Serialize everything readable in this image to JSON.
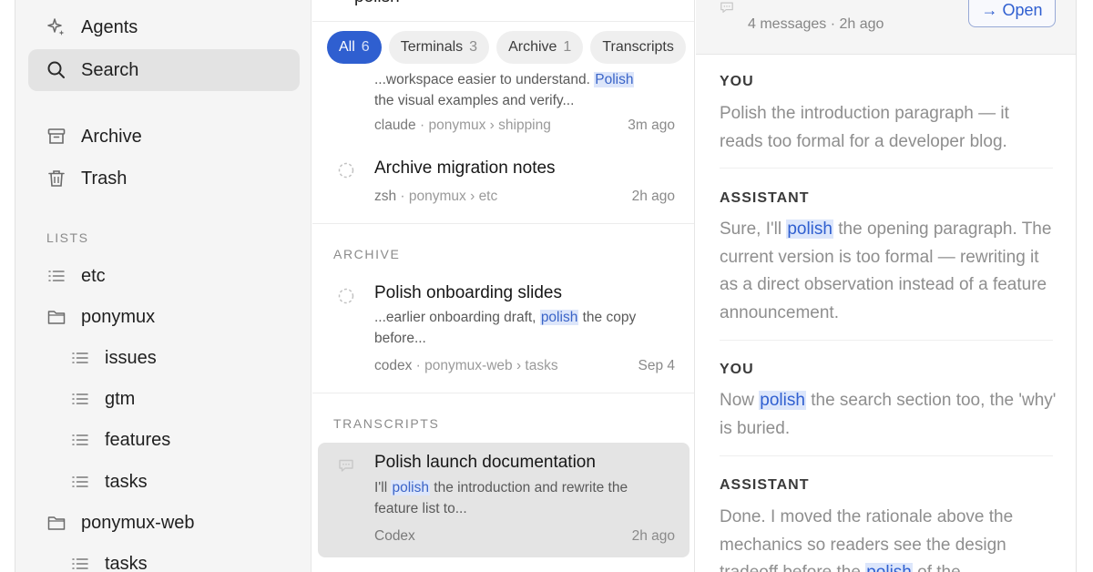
{
  "sidebar": {
    "nav": [
      {
        "label": "Agents",
        "icon": "sparkle-icon"
      },
      {
        "label": "Search",
        "icon": "search-icon",
        "active": true
      },
      {
        "label": "Archive",
        "icon": "archive-box-icon"
      },
      {
        "label": "Trash",
        "icon": "trash-icon"
      }
    ],
    "lists_label": "LISTS",
    "lists": [
      {
        "label": "etc",
        "icon": "list-icon"
      },
      {
        "label": "ponymux",
        "icon": "folder-icon"
      },
      {
        "label": "issues",
        "icon": "list-icon"
      },
      {
        "label": "gtm",
        "icon": "list-icon"
      },
      {
        "label": "features",
        "icon": "list-icon"
      },
      {
        "label": "tasks",
        "icon": "list-icon"
      },
      {
        "label": "ponymux-web",
        "icon": "folder-icon"
      },
      {
        "label": "tasks",
        "icon": "list-icon"
      }
    ]
  },
  "search": {
    "query_fragment": "polish"
  },
  "filters": [
    {
      "label": "All",
      "count": "6",
      "active": true
    },
    {
      "label": "Terminals",
      "count": "3"
    },
    {
      "label": "Archive",
      "count": "1"
    },
    {
      "label": "Transcripts",
      "count": ""
    }
  ],
  "results": {
    "item1": {
      "snippet_pre": "...workspace easier to understand. ",
      "snippet_mark": "Polish",
      "snippet_post": "",
      "snippet_line2": "the visual examples and verify...",
      "agent": "claude",
      "path": " · ponymux › shipping",
      "time": "3m ago"
    },
    "item2": {
      "title": "Archive migration notes",
      "agent": "zsh",
      "path": " · ponymux › etc",
      "time": "2h ago"
    },
    "archive_label": "ARCHIVE",
    "item3": {
      "title": "Polish onboarding slides",
      "snippet_pre": "...earlier onboarding draft, ",
      "snippet_mark": "polish",
      "snippet_post": " the copy before...",
      "agent": "codex",
      "path": " · ponymux-web › tasks",
      "time": "Sep 4"
    },
    "transcripts_label": "TRANSCRIPTS",
    "item4": {
      "title": "Polish launch documentation",
      "snippet_pre": "I'll ",
      "snippet_mark": "polish",
      "snippet_post": " the introduction and rewrite the feature list to...",
      "agent": "Codex",
      "time": "2h ago"
    }
  },
  "detail": {
    "message_count": "4 messages · 2h ago",
    "open_label": "→ Open",
    "messages": [
      {
        "role": "YOU",
        "pre": "Polish the introduction paragraph — it reads too formal for a developer blog.",
        "mark": "",
        "post": ""
      },
      {
        "role": "ASSISTANT",
        "pre": "Sure, I'll ",
        "mark": "polish",
        "post": " the opening paragraph. The current version is too formal — rewriting it as a direct observation instead of a feature announcement."
      },
      {
        "role": "YOU",
        "pre": "Now ",
        "mark": "polish",
        "post": " the search section too, the 'why' is buried."
      },
      {
        "role": "ASSISTANT",
        "pre": "Done. I moved the rationale above the mechanics so readers see the design tradeoff before the ",
        "mark": "polish",
        "post": " of the"
      }
    ]
  },
  "colors": {
    "accent": "#2f5fd0",
    "highlight": "#dce6fb",
    "sidebar_bg": "#f5f5f5",
    "selected_bg": "#e4e4e4"
  }
}
